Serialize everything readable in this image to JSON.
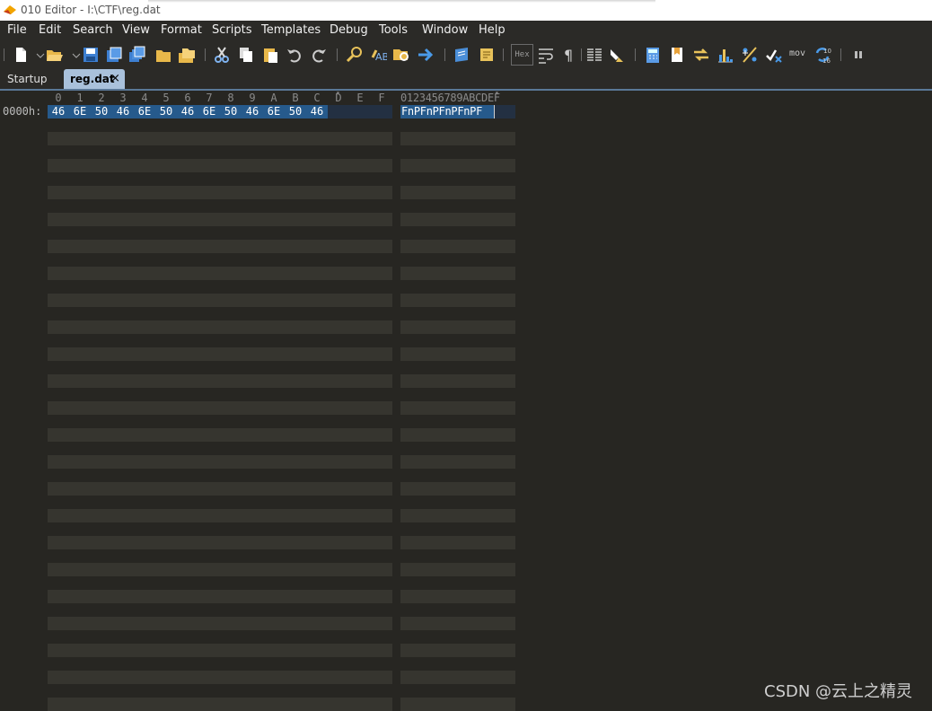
{
  "window": {
    "title": "010 Editor - I:\\CTF\\reg.dat"
  },
  "menu": [
    "File",
    "Edit",
    "Search",
    "View",
    "Format",
    "Scripts",
    "Templates",
    "Debug",
    "Tools",
    "Window",
    "Help"
  ],
  "toolbar": {
    "hex_toggle": "Hex",
    "mov_label": "mov",
    "icons": [
      "new-file-icon",
      "open-file-icon",
      "save-icon",
      "save-as-icon",
      "save-all-icon",
      "open-folder-icon",
      "workspace-icon",
      "cut-icon",
      "copy-icon",
      "paste-icon",
      "undo-icon",
      "redo-icon",
      "find-icon",
      "replace-icon",
      "find-in-files-icon",
      "goto-icon",
      "run-template-icon",
      "run-script-icon",
      "hex-mode-icon",
      "word-wrap-icon",
      "pilcrow-icon",
      "columns-icon",
      "highlight-icon",
      "calculator-icon",
      "bookmark-icon",
      "compare-icon",
      "histogram-icon",
      "percent-icon",
      "checksum-icon",
      "disassembler-icon",
      "base-converter-icon",
      "pause-icon"
    ]
  },
  "tabs": {
    "startup": "Startup",
    "active": "reg.dat",
    "close": "×"
  },
  "editor": {
    "columns": [
      "0",
      "1",
      "2",
      "3",
      "4",
      "5",
      "6",
      "7",
      "8",
      "9",
      "A",
      "B",
      "C",
      "D",
      "E",
      "F"
    ],
    "ascii_header": "0123456789ABCDEF",
    "rows": [
      {
        "address": "0000h:",
        "bytes": [
          "46",
          "6E",
          "50",
          "46",
          "6E",
          "50",
          "46",
          "6E",
          "50",
          "46",
          "6E",
          "50",
          "46"
        ],
        "ascii": "FnPFnPFnPFnPF"
      }
    ]
  },
  "colors": {
    "background": "#272622",
    "stripe": "#36352f",
    "selection": "#265a8c",
    "active_tab": "#a9c1db"
  },
  "watermark": "CSDN @云上之精灵"
}
